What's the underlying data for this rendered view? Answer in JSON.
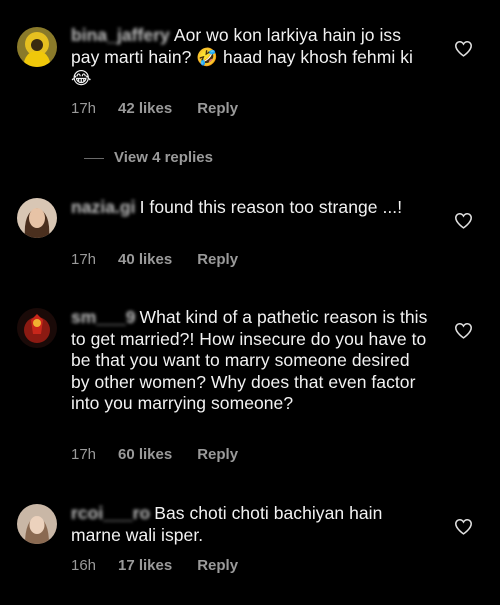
{
  "comments": [
    {
      "username": "bina_jaffery",
      "text": "Aor wo kon larkiya hain jo iss pay marti hain? 🤣 haad hay khosh fehmi ki😂",
      "time": "17h",
      "likes": "42 likes",
      "reply": "Reply",
      "avatar_icon": "avatar-yellow-hood"
    },
    {
      "username": "nazia.gi",
      "text": "I found  this reason too strange ...!",
      "time": "17h",
      "likes": "40 likes",
      "reply": "Reply",
      "avatar_icon": "avatar-woman-photo"
    },
    {
      "username": "sm___9",
      "text": "What kind of a pathetic reason is this to get married?! How insecure do you have to be that you want to marry someone desired by other women? Why does that even factor into you marrying someone?",
      "time": "17h",
      "likes": "60 likes",
      "reply": "Reply",
      "avatar_icon": "avatar-red-figure"
    },
    {
      "username": "rcoi___ro",
      "text": "Bas choti choti bachiyan hain marne wali isper.",
      "time": "16h",
      "likes": "17 likes",
      "reply": "Reply",
      "avatar_icon": "avatar-light-photo"
    }
  ],
  "view_replies": "View 4 replies",
  "colors": {
    "background": "#000000",
    "text": "#f2f2f2",
    "muted": "#9a9a9a"
  },
  "icons": {
    "like": "heart-outline-icon"
  }
}
